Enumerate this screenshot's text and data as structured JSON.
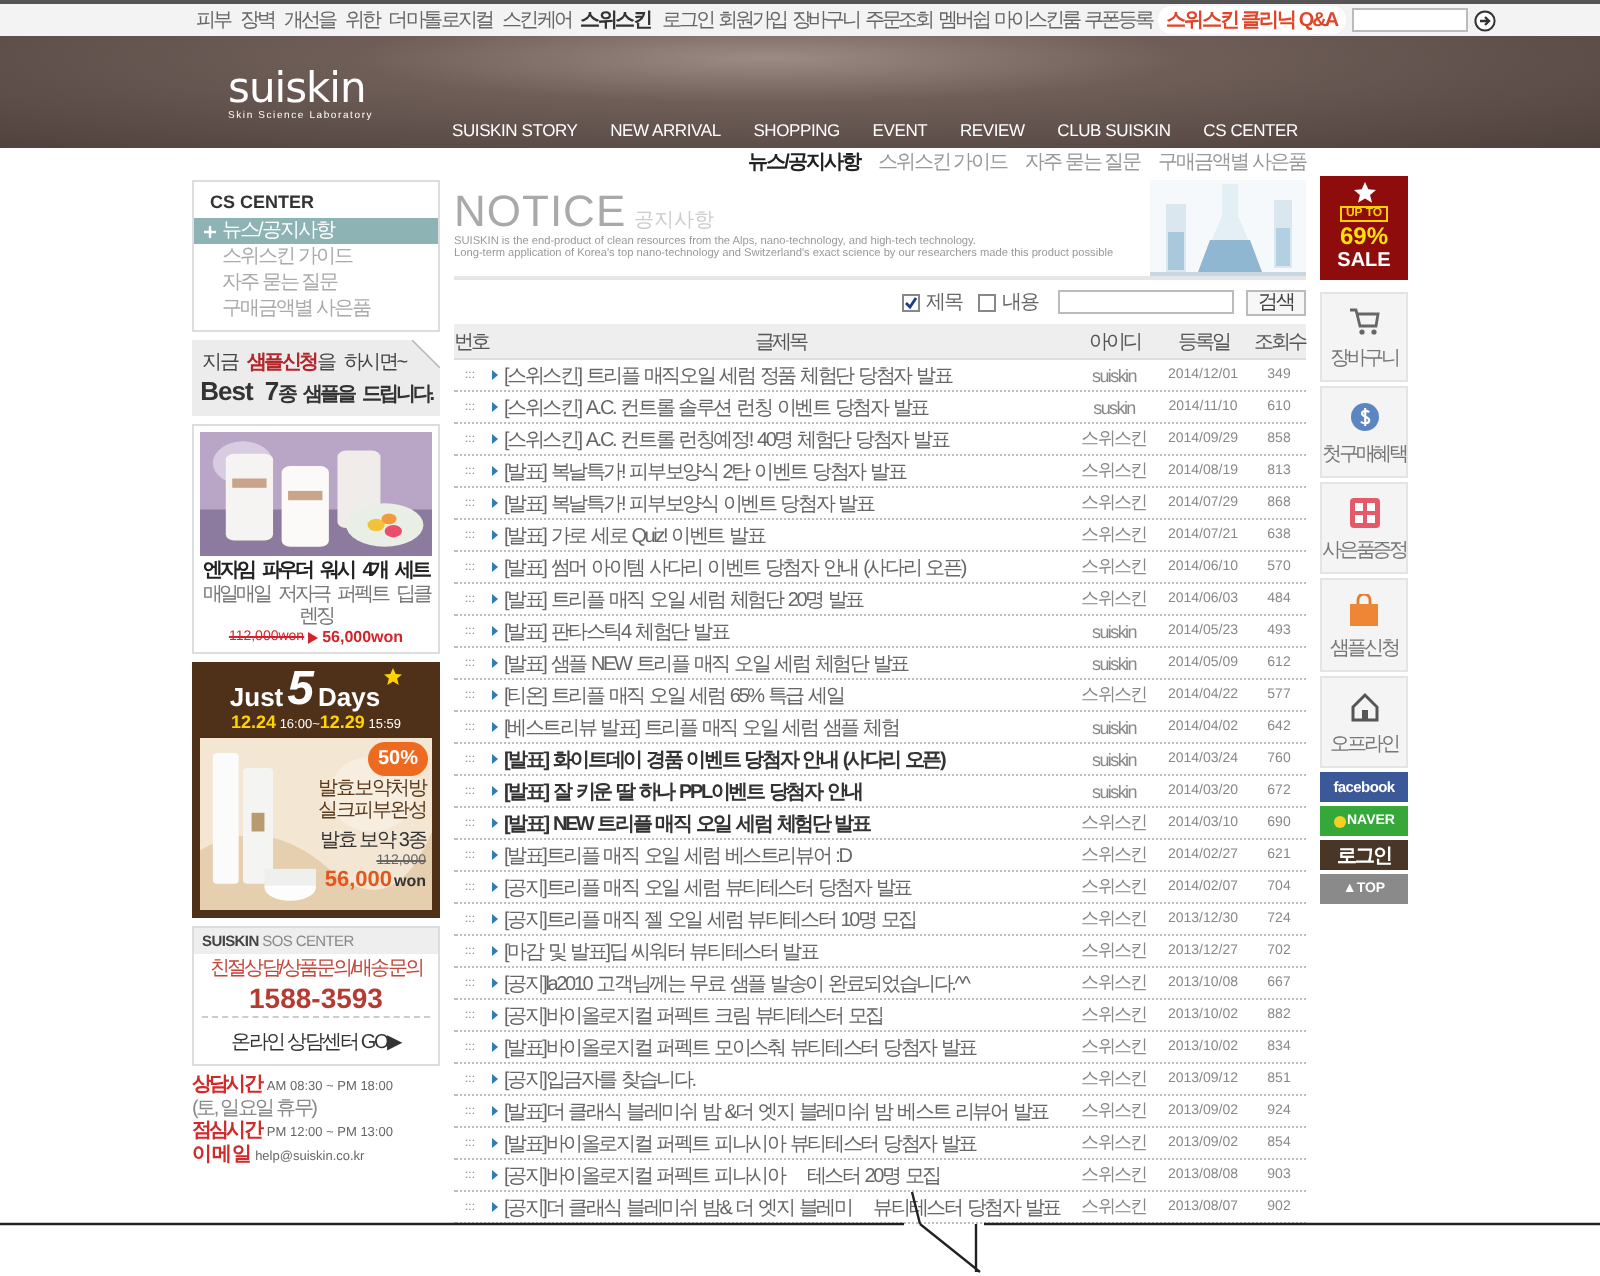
{
  "top_bar": {
    "tagline": "피부 장벽 개선을 위한 더마톨로지컬 스킨케어 **스위스킨**",
    "links": [
      "로그인",
      "회원가입",
      "장바구니",
      "주문조회",
      "멤버쉽",
      "마이스킨룸",
      "쿠폰등록"
    ],
    "clinic_link": "스위스킨 클리닉 Q&A"
  },
  "header": {
    "logo": "suiskin",
    "logo_subtitle": "Skin Science Laboratory",
    "nav": [
      "SUISKIN STORY",
      "NEW ARRIVAL",
      "SHOPPING",
      "EVENT",
      "REVIEW",
      "CLUB SUISKIN",
      "CS CENTER"
    ]
  },
  "sub_nav": [
    {
      "label": "뉴스/공지사항",
      "selected": true
    },
    {
      "label": "스위스킨 가이드",
      "selected": false
    },
    {
      "label": "자주 묻는 질문",
      "selected": false
    },
    {
      "label": "구매금액별 사은품",
      "selected": false
    }
  ],
  "sidebar": {
    "title": "CS CENTER",
    "items": [
      {
        "label": "뉴스/공지사항",
        "selected": true
      },
      {
        "label": "스위스킨 가이드",
        "selected": false
      },
      {
        "label": "자주 묻는 질문",
        "selected": false
      },
      {
        "label": "구매금액별 사은품",
        "selected": false
      }
    ],
    "sample_banner": {
      "line_1": "지금 **샘플신청**을 하시면~",
      "line_2": "**Best 7**종 샘플을 드립니다."
    },
    "product_banner": {
      "kind": "picture",
      "title": "엔자임 파우더 워시 4개 세트",
      "subtitle": "매일매일 저자극 퍼펙트 딥클렌징",
      "old_price": "112,000won",
      "new_price": "56,000won"
    },
    "event_banner": {
      "just": "Just",
      "number": "5",
      "days": "Days",
      "period": "**12.24** 16:00~**12.29** 15:59",
      "discount": "50%",
      "slogan": [
        "발효보약처방",
        "실크피부완성"
      ],
      "product": "발효 보약 3종",
      "old_price": "112,000",
      "new_price": "56,000",
      "currency": "won"
    },
    "sos_center": {
      "title": "**SUISKIN** SOS CENTER",
      "services": "친절상담/상품문의/배송문의",
      "phone": "1588-3593",
      "link": "온라인 상담센터 GO▶"
    },
    "contact": [
      {
        "label": "상담시간",
        "value": "AM 08:30 ~ PM 18:00",
        "note": "(토, 일요일 휴무)"
      },
      {
        "label": "점심시간",
        "value": "PM 12:00 ~ PM 13:00"
      },
      {
        "label": "이 메 일",
        "value": "help@suiskin.co.kr"
      }
    ]
  },
  "notice": {
    "title": "NOTICE",
    "title_ko": "공지사항",
    "description": [
      "SUISKIN is the end-product of clean resources from the Alps, nano-technology, and high-tech technology.",
      "Long-term application of Korea's top nano-technology and Switzerland's exact science by our researchers made this product possible"
    ]
  },
  "search": {
    "options": [
      {
        "label": "제목",
        "checked": true
      },
      {
        "label": "내용",
        "checked": false
      }
    ],
    "button": "검색"
  },
  "table": {
    "columns": [
      "번호",
      "글제목",
      "아이디",
      "등록일",
      "조회수"
    ],
    "rows": [
      {
        "number": ":::",
        "title": "[스위스킨] 트리플 매직오일 세럼 정품 체험단 당첨자 발표",
        "author": "suiskin",
        "date": "2014/12/01",
        "views": "349",
        "emphasized": false
      },
      {
        "number": ":::",
        "title": "[스위스킨] A.C. 컨트롤 솔루션 런칭 이벤트 당첨자 발표",
        "author": "suskin",
        "date": "2014/11/10",
        "views": "610",
        "emphasized": false
      },
      {
        "number": ":::",
        "title": "[스위스킨] A.C. 컨트롤 런칭예정! 40명 체험단 당첨자 발표",
        "author": "스위스킨",
        "date": "2014/09/29",
        "views": "858",
        "emphasized": false
      },
      {
        "number": ":::",
        "title": "[발표] 복날특가! 피부보양식 2탄 이벤트 당첨자 발표",
        "author": "스위스킨",
        "date": "2014/08/19",
        "views": "813",
        "emphasized": false
      },
      {
        "number": ":::",
        "title": "[발표] 복날특가! 피부보양식 이벤트 당첨자 발표",
        "author": "스위스킨",
        "date": "2014/07/29",
        "views": "868",
        "emphasized": false
      },
      {
        "number": ":::",
        "title": "[발표] 가로 세로 Quiz! 이벤트 발표",
        "author": "스위스킨",
        "date": "2014/07/21",
        "views": "638",
        "emphasized": false
      },
      {
        "number": ":::",
        "title": "[발표] 썸머 아이템 사다리 이벤트 당첨자 안내 (사다리 오픈)",
        "author": "스위스킨",
        "date": "2014/06/10",
        "views": "570",
        "emphasized": false
      },
      {
        "number": ":::",
        "title": "[발표] 트리플 매직 오일 세럼 체험단 20명 발표",
        "author": "스위스킨",
        "date": "2014/06/03",
        "views": "484",
        "emphasized": false
      },
      {
        "number": ":::",
        "title": "[발표] 판타스틱4 체험단 발표",
        "author": "suiskin",
        "date": "2014/05/23",
        "views": "493",
        "emphasized": false
      },
      {
        "number": ":::",
        "title": "[발표] 샘플 NEW 트리플 매직 오일 세럼 체험단 발표",
        "author": "suiskin",
        "date": "2014/05/09",
        "views": "612",
        "emphasized": false
      },
      {
        "number": ":::",
        "title": "[티온] 트리플 매직 오일 세럼 65% 특급 세일",
        "author": "스위스킨",
        "date": "2014/04/22",
        "views": "577",
        "emphasized": false
      },
      {
        "number": ":::",
        "title": "[베스트리뷰 발표] 트리플 매직 오일 세럼 샘플 체험",
        "author": "suiskin",
        "date": "2014/04/02",
        "views": "642",
        "emphasized": false
      },
      {
        "number": ":::",
        "title": "[발표] 화이트데이 경품 이벤트 당첨자 안내 (사다리 오픈)",
        "author": "suiskin",
        "date": "2014/03/24",
        "views": "760",
        "emphasized": true
      },
      {
        "number": ":::",
        "title": "[발표] 잘 키운 딸 하나 PPL이벤트 당첨자 안내",
        "author": "suiskin",
        "date": "2014/03/20",
        "views": "672",
        "emphasized": true
      },
      {
        "number": ":::",
        "title": "[발표] NEW 트리플 매직 오일 세럼 체험단 발표",
        "author": "스위스킨",
        "date": "2014/03/10",
        "views": "690",
        "emphasized": true
      },
      {
        "number": ":::",
        "title": "[발표]트리플 매직 오일 세럼 베스트리뷰어 :D",
        "author": "스위스킨",
        "date": "2014/02/27",
        "views": "621",
        "emphasized": false
      },
      {
        "number": ":::",
        "title": "[공지]트리플 매직 오일 세럼 뷰티테스터 당첨자 발표",
        "author": "스위스킨",
        "date": "2014/02/07",
        "views": "704",
        "emphasized": false
      },
      {
        "number": ":::",
        "title": "[공지]트리플 매직 젤 오일 세럼 뷰티테스터 10명 모집",
        "author": "스위스킨",
        "date": "2013/12/30",
        "views": "724",
        "emphasized": false
      },
      {
        "number": ":::",
        "title": "[마감 및 발표]딥 씨워터 뷰티테스터 발표",
        "author": "스위스킨",
        "date": "2013/12/27",
        "views": "702",
        "emphasized": false
      },
      {
        "number": ":::",
        "title": "[공지]la2010 고객님께는 무료 샘플 발송이 완료되었습니다.^^",
        "author": "스위스킨",
        "date": "2013/10/08",
        "views": "667",
        "emphasized": false
      },
      {
        "number": ":::",
        "title": "[공지]바이올로지컬 퍼펙트 크림 뷰티테스터 모집",
        "author": "스위스킨",
        "date": "2013/10/02",
        "views": "882",
        "emphasized": false
      },
      {
        "number": ":::",
        "title": "[발표]바이올로지컬 퍼펙트 모이스춰 뷰티테스터 당첨자 발표",
        "author": "스위스킨",
        "date": "2013/10/02",
        "views": "834",
        "emphasized": false
      },
      {
        "number": ":::",
        "title": "[공지]입금자를 찾습니다.",
        "author": "스위스킨",
        "date": "2013/09/12",
        "views": "851",
        "emphasized": false
      },
      {
        "number": ":::",
        "title": "[발표]더 클래식 블레미쉬 밤 &더 엣지 블레미쉬 밤 베스트 리뷰어 발표",
        "author": "스위스킨",
        "date": "2013/09/02",
        "views": "924",
        "emphasized": false
      },
      {
        "number": ":::",
        "title": "[발표]바이올로지컬 퍼펙트 피나시아 뷰티테스터 당첨자 발표",
        "author": "스위스킨",
        "date": "2013/09/02",
        "views": "854",
        "emphasized": false
      },
      {
        "number": ":::",
        "title": "[공지]바이올로지컬 퍼펙트 피나시아",
        "title_rest": "테스터 20명 모집",
        "author": "스위스킨",
        "date": "2013/08/08",
        "views": "903",
        "emphasized": false
      },
      {
        "number": ":::",
        "title": "[공지]더 클래식 블레미쉬 밤& 더 엣지 블레미",
        "title_rest": "뷰티테스터 당첨자 발표",
        "author": "스위스킨",
        "date": "2013/08/07",
        "views": "902",
        "emphasized": false
      }
    ]
  },
  "quick_bar": {
    "sale": {
      "up_to": "UP TO",
      "percent": "69%",
      "label": "SALE"
    },
    "items": [
      {
        "kind": "cart",
        "label": "장바구니"
      },
      {
        "kind": "coin",
        "label": "첫구매혜택"
      },
      {
        "kind": "gift",
        "label": "사은품증정"
      },
      {
        "kind": "bag",
        "label": "샘플신청"
      },
      {
        "kind": "home",
        "label": "오프라인"
      }
    ],
    "buttons": [
      {
        "kind": "facebook",
        "label": "facebook"
      },
      {
        "kind": "naver",
        "label": "NAVER"
      },
      {
        "kind": "login",
        "label": "로그인"
      },
      {
        "kind": "top",
        "label": "▲TOP"
      }
    ]
  }
}
